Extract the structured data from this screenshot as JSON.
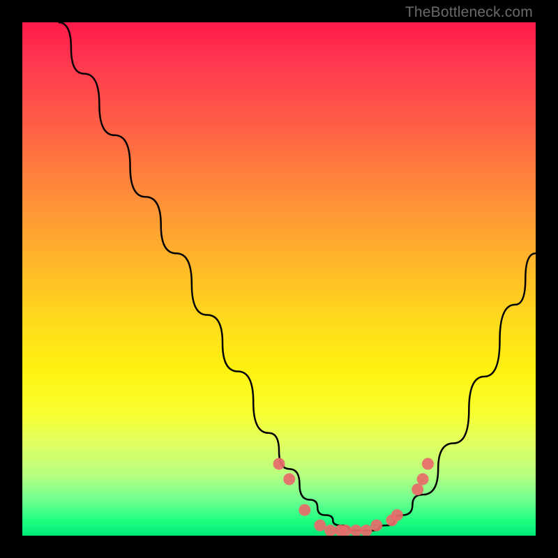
{
  "watermark": "TheBottleneck.com",
  "chart_data": {
    "type": "line",
    "title": "",
    "xlabel": "",
    "ylabel": "",
    "xlim": [
      0,
      100
    ],
    "ylim": [
      0,
      100
    ],
    "series": [
      {
        "name": "curve",
        "x": [
          7,
          12,
          18,
          24,
          30,
          36,
          42,
          48,
          52,
          56,
          59,
          62,
          65,
          68,
          71,
          74,
          78,
          84,
          90,
          96,
          100
        ],
        "y": [
          100,
          90,
          78,
          66,
          55,
          43,
          32,
          20,
          13,
          7,
          4,
          2,
          1,
          1,
          2,
          4,
          8,
          18,
          31,
          45,
          55
        ]
      }
    ],
    "markers": [
      {
        "x": 50,
        "y": 14
      },
      {
        "x": 52,
        "y": 11
      },
      {
        "x": 55,
        "y": 5
      },
      {
        "x": 58,
        "y": 2
      },
      {
        "x": 60,
        "y": 1
      },
      {
        "x": 62,
        "y": 1
      },
      {
        "x": 63,
        "y": 1
      },
      {
        "x": 65,
        "y": 1
      },
      {
        "x": 67,
        "y": 1
      },
      {
        "x": 69,
        "y": 2
      },
      {
        "x": 72,
        "y": 3
      },
      {
        "x": 73,
        "y": 4
      },
      {
        "x": 77,
        "y": 9
      },
      {
        "x": 78,
        "y": 11
      },
      {
        "x": 79,
        "y": 14
      }
    ],
    "marker_color": "#e86a6a",
    "line_color": "#000000"
  }
}
